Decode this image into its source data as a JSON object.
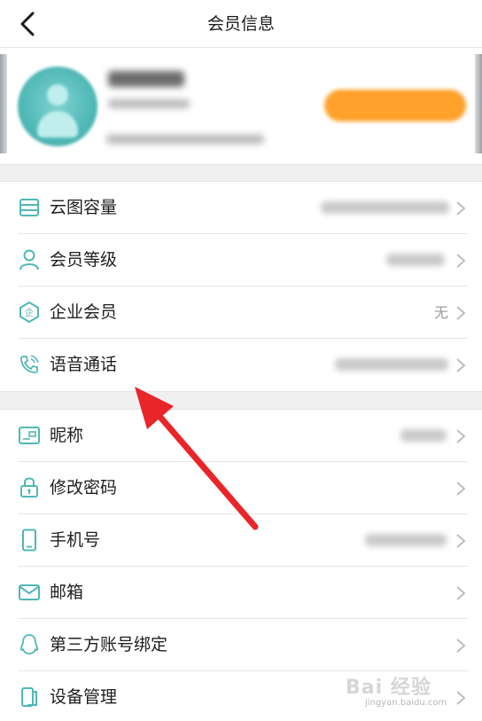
{
  "header": {
    "title": "会员信息",
    "back_icon": "chevron-left-icon"
  },
  "colors": {
    "accent_teal": "#4fb8b6",
    "renew_orange": "#ffa12a",
    "arrow_red": "#e8262a",
    "background_gap": "#f0f0f0"
  },
  "section_membership": [
    {
      "id": "cloud-storage",
      "label": "云图容量",
      "icon": "storage-icon",
      "value": ""
    },
    {
      "id": "member-level",
      "label": "会员等级",
      "icon": "user-icon",
      "value": ""
    },
    {
      "id": "enterprise-member",
      "label": "企业会员",
      "icon": "enterprise-badge-icon",
      "value": "无"
    },
    {
      "id": "voice-call",
      "label": "语音通话",
      "icon": "phone-call-icon",
      "value": ""
    }
  ],
  "section_account": [
    {
      "id": "nickname",
      "label": "昵称",
      "icon": "id-card-icon",
      "value": ""
    },
    {
      "id": "change-password",
      "label": "修改密码",
      "icon": "lock-icon",
      "value": ""
    },
    {
      "id": "phone-number",
      "label": "手机号",
      "icon": "mobile-phone-icon",
      "value": ""
    },
    {
      "id": "email",
      "label": "邮箱",
      "icon": "mail-icon",
      "value": ""
    },
    {
      "id": "third-party-binding",
      "label": "第三方账号绑定",
      "icon": "qq-penguin-icon",
      "value": ""
    },
    {
      "id": "device-management",
      "label": "设备管理",
      "icon": "device-icon",
      "value": ""
    }
  ],
  "watermark": {
    "brand": "Bai 经验",
    "url": "jingyan.baidu.com"
  }
}
